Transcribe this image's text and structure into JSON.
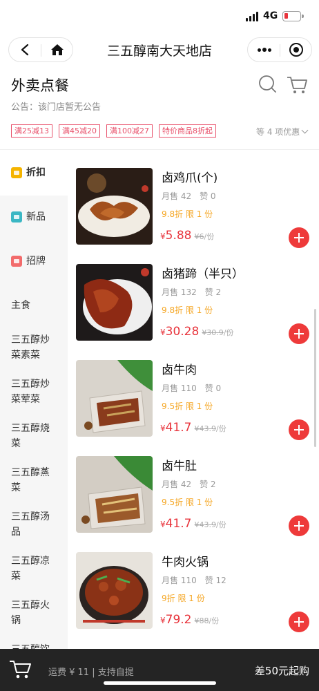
{
  "status_bar": {
    "network": "4G"
  },
  "nav": {
    "title": "三五醇南大天地店"
  },
  "header": {
    "title": "外卖点餐",
    "notice": "公告：该门店暂无公告",
    "promos": [
      "满25减13",
      "满45减20",
      "满100减27",
      "特价商品8折起"
    ],
    "promo_more": "等 4 项优惠"
  },
  "sidebar": {
    "items": [
      {
        "label": "折扣",
        "icon": "discount-icon",
        "color": "#f5b400"
      },
      {
        "label": "新品",
        "icon": "new-icon",
        "color": "#3bb7c4"
      },
      {
        "label": "招牌",
        "icon": "signature-icon",
        "color": "#f26b6b"
      },
      {
        "label": "主食"
      },
      {
        "label": "三五醇炒菜素菜"
      },
      {
        "label": "三五醇炒菜荤菜"
      },
      {
        "label": "三五醇烧菜"
      },
      {
        "label": "三五醇蒸菜"
      },
      {
        "label": "三五醇汤品"
      },
      {
        "label": "三五醇凉菜"
      },
      {
        "label": "三五醇火锅"
      },
      {
        "label": "三五醇饮"
      }
    ]
  },
  "products": [
    {
      "name": "卤鸡爪(个)",
      "sales": "月售 42",
      "likes": "赞 0",
      "discount": "9.8折 限 1 份",
      "price": "5.88",
      "orig": "¥6",
      "unit": "/份"
    },
    {
      "name": "卤猪蹄（半只）",
      "sales": "月售 132",
      "likes": "赞 2",
      "discount": "9.8折 限 1 份",
      "price": "30.28",
      "orig": "¥30.9",
      "unit": "/份"
    },
    {
      "name": "卤牛肉",
      "sales": "月售 110",
      "likes": "赞 0",
      "discount": "9.5折 限 1 份",
      "price": "41.7",
      "orig": "¥43.9",
      "unit": "/份"
    },
    {
      "name": "卤牛肚",
      "sales": "月售 42",
      "likes": "赞 2",
      "discount": "9.5折 限 1 份",
      "price": "41.7",
      "orig": "¥43.9",
      "unit": "/份"
    },
    {
      "name": "牛肉火锅",
      "sales": "月售 110",
      "likes": "赞 12",
      "discount": "9折 限 1 份",
      "price": "79.2",
      "orig": "¥88",
      "unit": "/份"
    }
  ],
  "currency": "¥",
  "bottom_bar": {
    "fee": "运费 ¥ 11 | 支持自提",
    "min_order": "差50元起购"
  },
  "colors": {
    "accent_red": "#e8343c",
    "discount_orange": "#f5a623",
    "bottom_bar": "#242424"
  }
}
